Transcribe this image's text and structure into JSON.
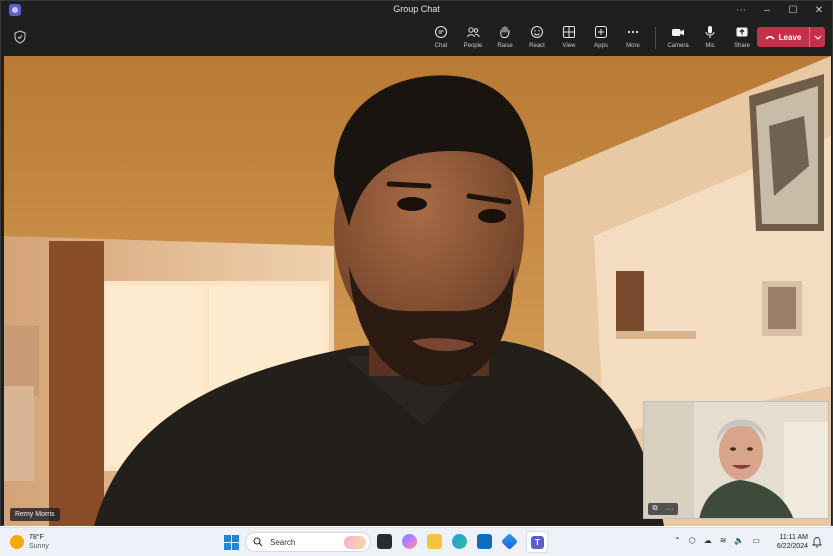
{
  "window": {
    "title": "Group Chat",
    "controls": [
      "⋯",
      "–",
      "☐",
      "✕"
    ]
  },
  "toolbar": {
    "tools": [
      {
        "label": "Chat",
        "icon": "chat-icon"
      },
      {
        "label": "People",
        "icon": "people-icon"
      },
      {
        "label": "Raise",
        "icon": "raise-hand-icon"
      },
      {
        "label": "React",
        "icon": "react-icon"
      },
      {
        "label": "View",
        "icon": "view-icon"
      },
      {
        "label": "Apps",
        "icon": "apps-icon"
      },
      {
        "label": "More",
        "icon": "more-icon"
      }
    ],
    "media": [
      {
        "label": "Camera",
        "icon": "camera-icon"
      },
      {
        "label": "Mic",
        "icon": "mic-icon"
      },
      {
        "label": "Share",
        "icon": "share-icon"
      }
    ],
    "leave_label": "Leave"
  },
  "stage": {
    "participant_name": "Remy Morris"
  },
  "pip": {
    "more": "···"
  },
  "taskbar": {
    "weather": {
      "temp": "78°F",
      "condition": "Sunny"
    },
    "search_placeholder": "Search",
    "clock": {
      "time": "11:11 AM",
      "date": "6/22/2024"
    }
  },
  "colors": {
    "leave": "#c4314b",
    "teams_purple": "#5b5fc7",
    "toolbar_bg": "#1f1f1f"
  }
}
